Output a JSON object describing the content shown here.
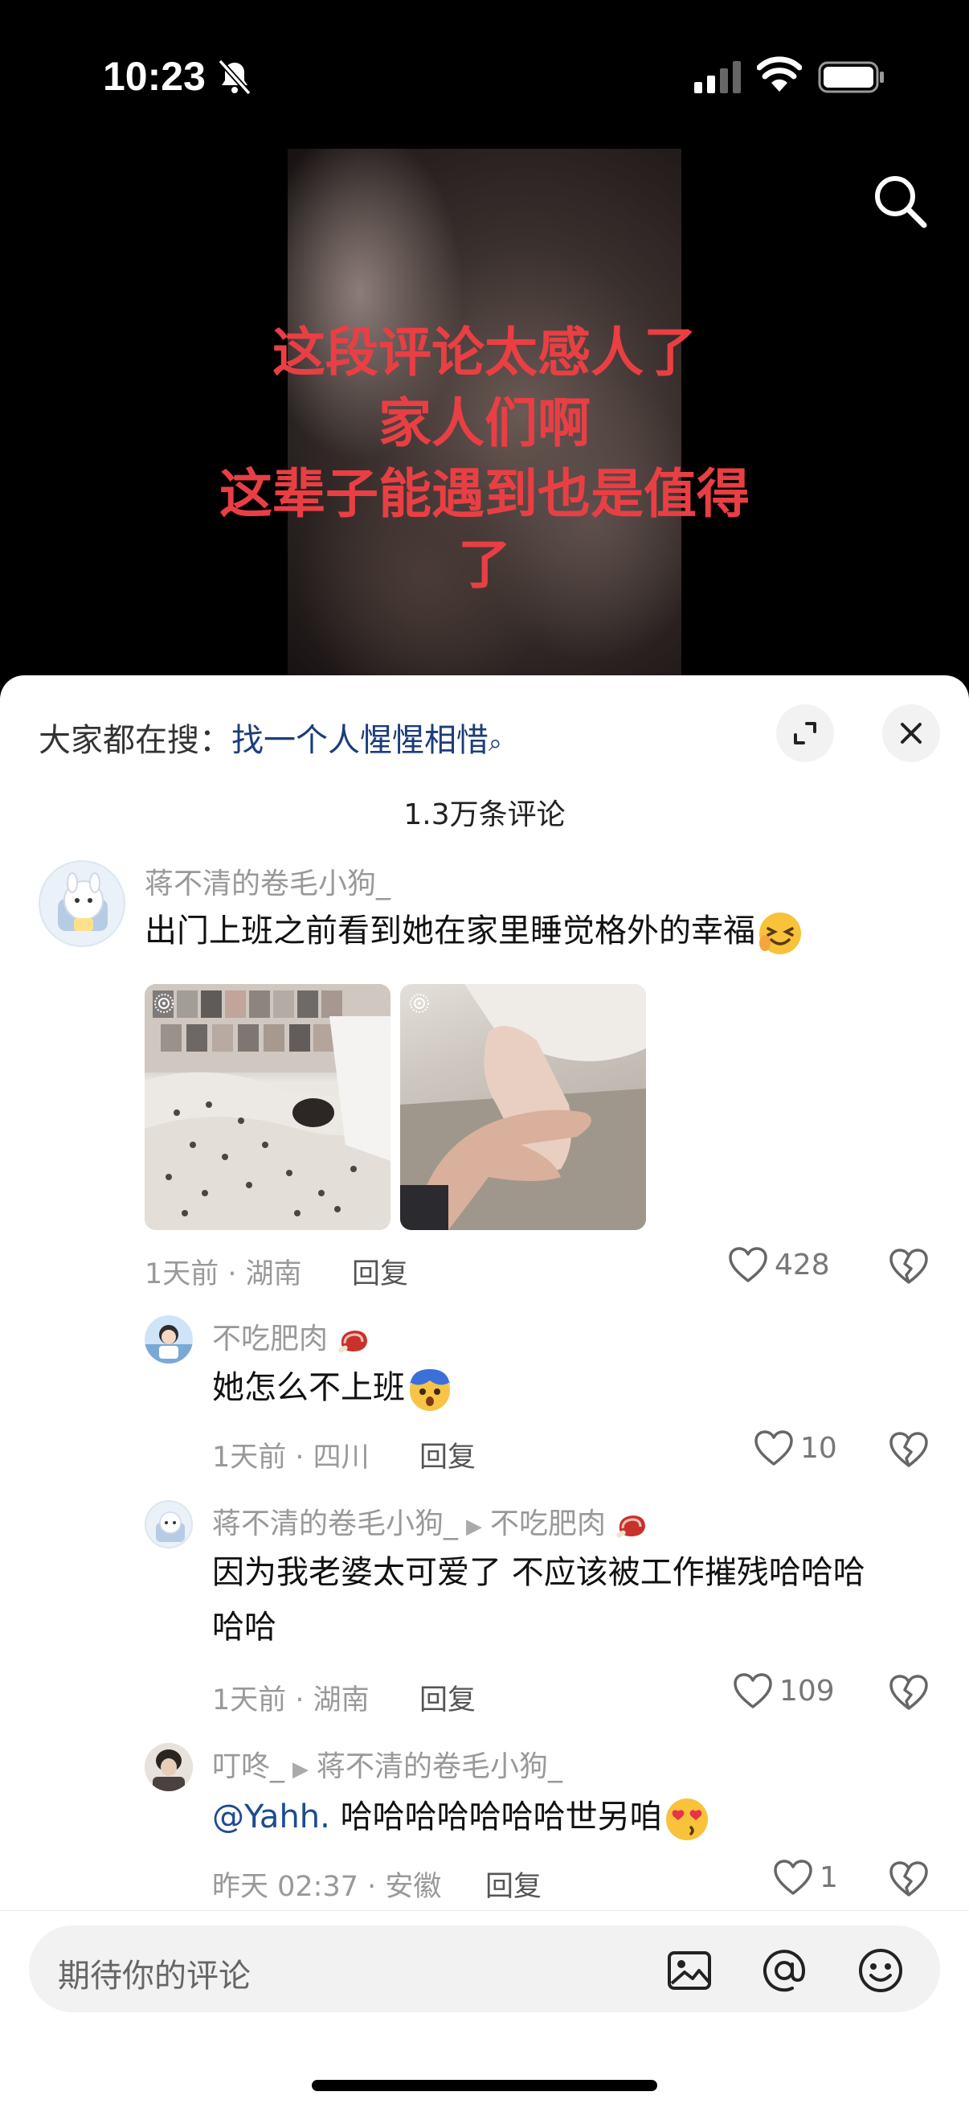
{
  "status_bar": {
    "time": "10:23",
    "icons": [
      "bell-slash-icon",
      "cellular-signal-icon",
      "wifi-icon",
      "battery-icon"
    ]
  },
  "video": {
    "caption_lines": [
      "这段评论太感人了",
      "家人们啊",
      "这辈子能遇到也是值得",
      "了"
    ],
    "caption_color": "#e93f44"
  },
  "sheet": {
    "hot_search_label": "大家都在搜：",
    "hot_search_keyword": "找一个人惺惺相惜",
    "comment_count": "1.3万条评论",
    "input_placeholder": "期待你的评论"
  },
  "comments": [
    {
      "user": "蒋不清的卷毛小狗_",
      "text": "出门上班之前看到她在家里睡觉格外的幸福",
      "meta": "1天前 · 湖南",
      "reply": "回复",
      "likes": "428"
    },
    {
      "user": "不吃肥肉",
      "text": "她怎么不上班",
      "meta": "1天前 · 四川",
      "reply": "回复",
      "likes": "10"
    },
    {
      "user": "蒋不清的卷毛小狗_",
      "reply_to": "不吃肥肉",
      "text_line1": "因为我老婆太可爱了 不应该被工作摧残哈哈哈",
      "text_line2": "哈哈",
      "meta": "1天前 · 湖南",
      "reply": "回复",
      "likes": "109"
    },
    {
      "user": "叮咚_",
      "reply_to": "蒋不清的卷毛小狗_",
      "mention": "@Yahh.",
      "text": " 哈哈哈哈哈哈哈世另咱",
      "meta": "昨天 02:37 · 安徽",
      "reply": "回复",
      "likes": "1"
    }
  ],
  "colors": {
    "accent_link": "#1d3d7a",
    "secondary_text": "#999999"
  }
}
